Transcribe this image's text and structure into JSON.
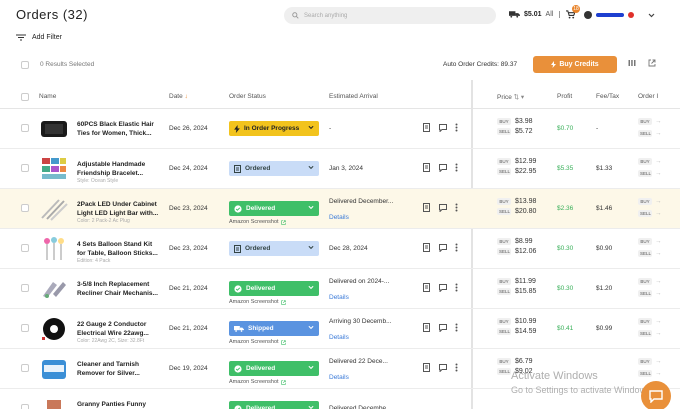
{
  "header": {
    "title": "Orders (32)",
    "search_placeholder": "Search anything",
    "credits": "$5.01",
    "credits_scope": "All",
    "notifications": "18"
  },
  "toolbar": {
    "add_filter": "Add Filter",
    "results_selected": "0 Results Selected",
    "auto_order_credits": "Auto Order Credits: 89.37",
    "buy_credits": "Buy Credits"
  },
  "columns": {
    "name": "Name",
    "date": "Date",
    "order_status": "Order Status",
    "estimated_arrival": "Estimated Arrival",
    "price": "Price",
    "profit": "Profit",
    "fee_tax": "Fee/Tax",
    "order_id": "Order I"
  },
  "price_tags": {
    "buy": "BUY",
    "sell": "SELL"
  },
  "rows": [
    {
      "name1": "60PCS Black Elastic Hair",
      "name2": "Ties for Women, Thick...",
      "sub": "",
      "date": "Dec 26, 2024",
      "status": "In Order Progress",
      "status_type": "prog",
      "amazon": "",
      "arrival": "-",
      "arrival2": "",
      "details": "",
      "buy": "$3.98",
      "sell": "$5.72",
      "profit": "$0.70",
      "fee": "-"
    },
    {
      "name1": "Adjustable Handmade",
      "name2": "Friendship Bracelet...",
      "sub": "Style: Ocean Style",
      "date": "Dec 24, 2024",
      "status": "Ordered",
      "status_type": "ord",
      "amazon": "",
      "arrival": "Jan 3, 2024",
      "arrival2": "",
      "details": "",
      "buy": "$12.99",
      "sell": "$22.95",
      "profit": "$5.35",
      "fee": "$1.33"
    },
    {
      "name1": "2Pack LED Under Cabinet",
      "name2": "Light LED Light Bar with...",
      "sub": "Color: 2 Pack-2 Ac Plug",
      "date": "Dec 23, 2024",
      "status": "Delivered",
      "status_type": "del",
      "amazon": "Amazon Screenshot",
      "arrival": "Delivered December...",
      "arrival2": "",
      "details": "Details",
      "buy": "$13.98",
      "sell": "$20.80",
      "profit": "$2.36",
      "fee": "$1.46"
    },
    {
      "name1": "4 Sets Balloon Stand Kit",
      "name2": "for Table, Balloon Sticks...",
      "sub": "Edition: 4 Pack",
      "date": "Dec 23, 2024",
      "status": "Ordered",
      "status_type": "ord",
      "amazon": "",
      "arrival": "Dec 28, 2024",
      "arrival2": "",
      "details": "",
      "buy": "$8.99",
      "sell": "$12.06",
      "profit": "$0.30",
      "fee": "$0.90"
    },
    {
      "name1": "3-5/8 Inch Replacement",
      "name2": "Recliner Chair Mechanis...",
      "sub": "",
      "date": "Dec 21, 2024",
      "status": "Delivered",
      "status_type": "del",
      "amazon": "Amazon Screenshot",
      "arrival": "Delivered on 2024-...",
      "arrival2": "",
      "details": "Details",
      "buy": "$11.99",
      "sell": "$15.85",
      "profit": "$0.30",
      "fee": "$1.20"
    },
    {
      "name1": "22 Gauge 2 Conductor",
      "name2": "Electrical Wire 22awg...",
      "sub": "Color: 22Awg 2C, Size: 32.8Ft",
      "date": "Dec 21, 2024",
      "status": "Shipped",
      "status_type": "ship",
      "amazon": "Amazon Screenshot",
      "arrival": "Arriving 30 Decemb...",
      "arrival2": "",
      "details": "Details",
      "buy": "$10.99",
      "sell": "$14.59",
      "profit": "$0.41",
      "fee": "$0.99"
    },
    {
      "name1": "Cleaner and Tarnish",
      "name2": "Remover for Silver...",
      "sub": "",
      "date": "Dec 19, 2024",
      "status": "Delivered",
      "status_type": "del",
      "amazon": "Amazon Screenshot",
      "arrival": "Delivered 22 Dece...",
      "arrival2": "",
      "details": "Details",
      "buy": "$6.79",
      "sell": "$9.02",
      "profit": "",
      "fee": ""
    },
    {
      "name1": "Granny Panties Funny",
      "name2": "",
      "sub": "",
      "date": "",
      "status": "Delivered",
      "status_type": "del",
      "amazon": "",
      "arrival": "Delivered Decembe...",
      "arrival2": "",
      "details": "",
      "buy": "",
      "sell": "",
      "profit": "",
      "fee": ""
    }
  ],
  "watermark": {
    "title": "Activate Windows",
    "subtitle": "Go to Settings to activate Windows."
  }
}
